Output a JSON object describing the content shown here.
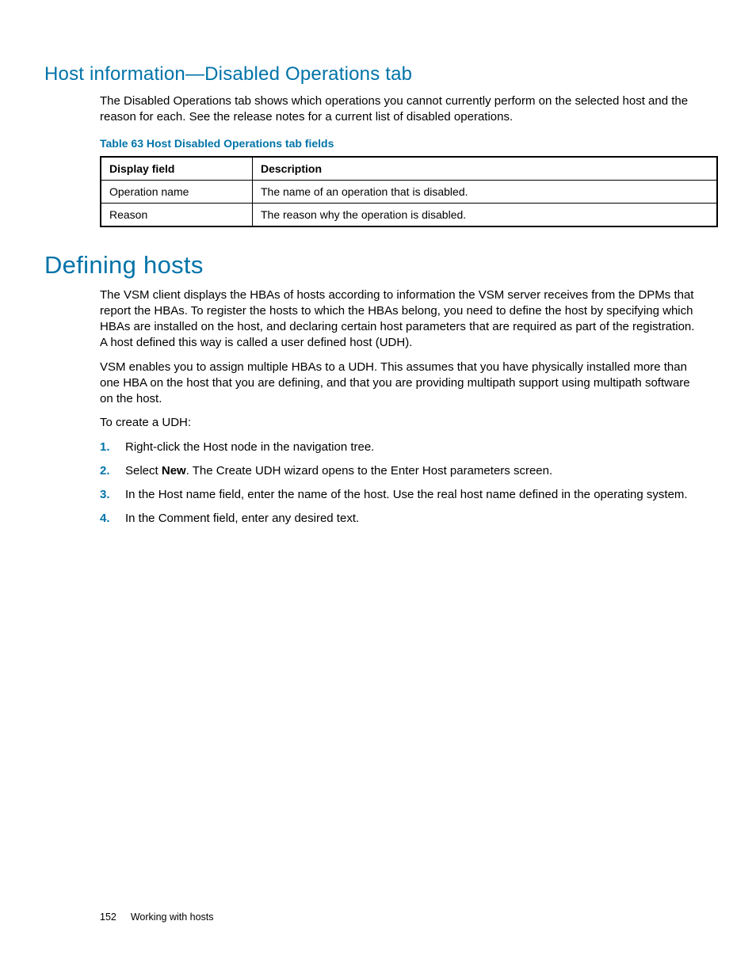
{
  "section1": {
    "heading": "Host information—Disabled Operations tab",
    "intro": "The Disabled Operations tab shows which operations you cannot currently perform on the selected host and the reason for each. See the release notes for a current list of disabled operations.",
    "tableCaption": "Table 63 Host Disabled Operations tab fields",
    "tableHeaders": {
      "c1": "Display field",
      "c2": "Description"
    },
    "rows": [
      {
        "c1": "Operation name",
        "c2": "The name of an operation that is disabled."
      },
      {
        "c1": "Reason",
        "c2": "The reason why the operation is disabled."
      }
    ]
  },
  "section2": {
    "heading": "Defining hosts",
    "para1": "The VSM client displays the HBAs of hosts according to information the VSM server receives from the DPMs that report the HBAs. To register the hosts to which the HBAs belong, you need to define the host by specifying which HBAs are installed on the host, and declaring certain host parameters that are required as part of the registration. A host defined this way is called a user defined host (UDH).",
    "para2": "VSM enables you to assign multiple HBAs to a UDH. This assumes that you have physically installed more than one HBA on the host that you are defining, and that you are providing multipath support using multipath software on the host.",
    "para3": "To create a UDH:",
    "steps": {
      "s1": "Right-click the Host node in the navigation tree.",
      "s2_pre": "Select ",
      "s2_bold": "New",
      "s2_post": ". The Create UDH wizard opens to the Enter Host parameters screen.",
      "s3": "In the Host name field, enter the name of the host. Use the real host name defined in the operating system.",
      "s4": "In the Comment field, enter any desired text."
    }
  },
  "footer": {
    "pageNumber": "152",
    "chapter": "Working with hosts"
  }
}
